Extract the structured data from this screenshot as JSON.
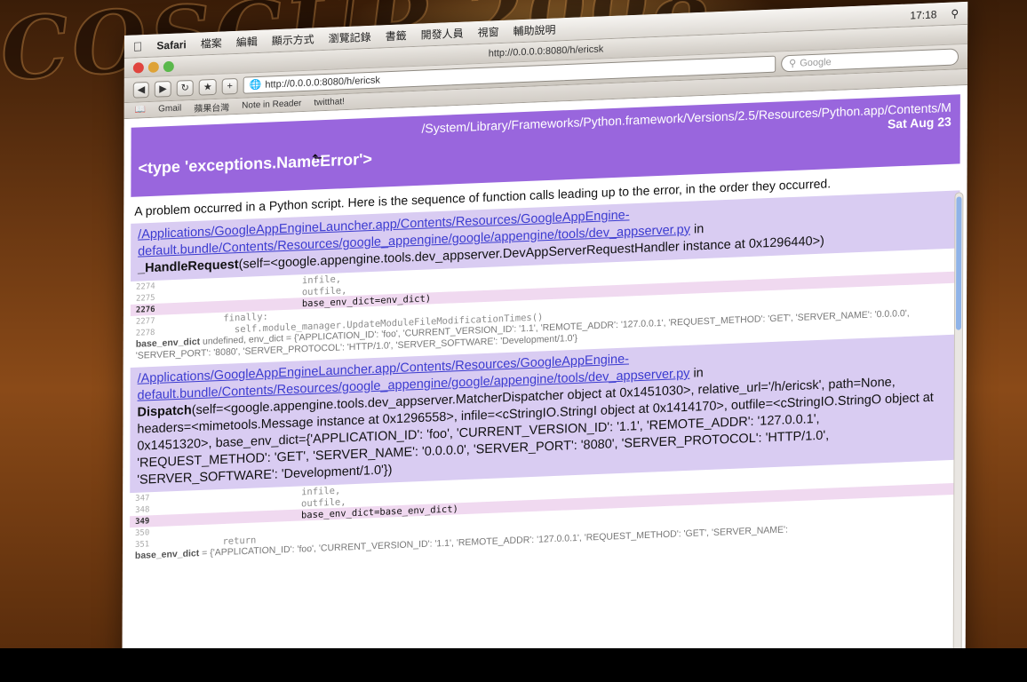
{
  "menubar": {
    "app": "Safari",
    "items": [
      "檔案",
      "編輯",
      "顯示方式",
      "瀏覽記錄",
      "書籤",
      "開發人員",
      "視窗",
      "輔助說明"
    ],
    "clock": "17:18"
  },
  "window": {
    "title": "http://0.0.0.0:8080/h/ericsk"
  },
  "toolbar": {
    "url": "http://0.0.0.0:8080/h/ericsk",
    "search_placeholder": "Google"
  },
  "bookmarks": [
    "Gmail",
    "蘋果台灣",
    "Note in Reader",
    "twitthat!"
  ],
  "error": {
    "type": "<type 'exceptions.NameError'>",
    "path": "/System/Library/Frameworks/Python.framework/Versions/2.5/Resources/Python.app/Contents/M",
    "date": "Sat Aug 23",
    "intro": "A problem occurred in a Python script. Here is the sequence of function calls leading up to the error, in the order they occurred."
  },
  "frames": [
    {
      "link1": "/Applications/GoogleAppEngineLauncher.app/Contents/Resources/GoogleAppEngine-",
      "link2": "default.bundle/Contents/Resources/google_appengine/google/appengine/tools/dev_appserver.py",
      "in": " in",
      "call": "_HandleRequest",
      "args": "(self=<google.appengine.tools.dev_appserver.DevAppServerRequestHandler instance at 0x1296440>)",
      "code": [
        {
          "ln": "2274",
          "src": "                      infile,",
          "hl": false
        },
        {
          "ln": "2275",
          "src": "                      outfile,",
          "hl": false
        },
        {
          "ln": "2276",
          "src": "                      base_env_dict=env_dict)",
          "hl": true
        },
        {
          "ln": "2277",
          "src": "        finally:",
          "hl": false
        },
        {
          "ln": "2278",
          "src": "          self.module_manager.UpdateModuleFileModificationTimes()",
          "hl": false
        }
      ],
      "locals_name": "base_env_dict",
      "locals_rest": " undefined, env_dict = {'APPLICATION_ID': 'foo', 'CURRENT_VERSION_ID': '1.1', 'REMOTE_ADDR': '127.0.0.1', 'REQUEST_METHOD': 'GET', 'SERVER_NAME': '0.0.0.0', 'SERVER_PORT': '8080', 'SERVER_PROTOCOL': 'HTTP/1.0', 'SERVER_SOFTWARE': 'Development/1.0'}"
    },
    {
      "link1": "/Applications/GoogleAppEngineLauncher.app/Contents/Resources/GoogleAppEngine-",
      "link2": "default.bundle/Contents/Resources/google_appengine/google/appengine/tools/dev_appserver.py",
      "in": " in",
      "call": "Dispatch",
      "args": "(self=<google.appengine.tools.dev_appserver.MatcherDispatcher object at 0x1451030>, relative_url='/h/ericsk', path=None, headers=<mimetools.Message instance at 0x1296558>, infile=<cStringIO.StringI object at 0x1414170>, outfile=<cStringIO.StringO object at 0x1451320>, base_env_dict={'APPLICATION_ID': 'foo', 'CURRENT_VERSION_ID': '1.1', 'REMOTE_ADDR': '127.0.0.1', 'REQUEST_METHOD': 'GET', 'SERVER_NAME': '0.0.0.0', 'SERVER_PORT': '8080', 'SERVER_PROTOCOL': 'HTTP/1.0', 'SERVER_SOFTWARE': 'Development/1.0'})",
      "code": [
        {
          "ln": "347",
          "src": "                      infile,",
          "hl": false
        },
        {
          "ln": "348",
          "src": "                      outfile,",
          "hl": false
        },
        {
          "ln": "349",
          "src": "                      base_env_dict=base_env_dict)",
          "hl": true
        },
        {
          "ln": "350",
          "src": "",
          "hl": false
        },
        {
          "ln": "351",
          "src": "        return",
          "hl": false
        }
      ],
      "locals_name": "base_env_dict",
      "locals_rest": " = {'APPLICATION_ID': 'foo', 'CURRENT_VERSION_ID': '1.1', 'REMOTE_ADDR': '127.0.0.1', 'REQUEST_METHOD': 'GET', 'SERVER_NAME':"
    }
  ]
}
